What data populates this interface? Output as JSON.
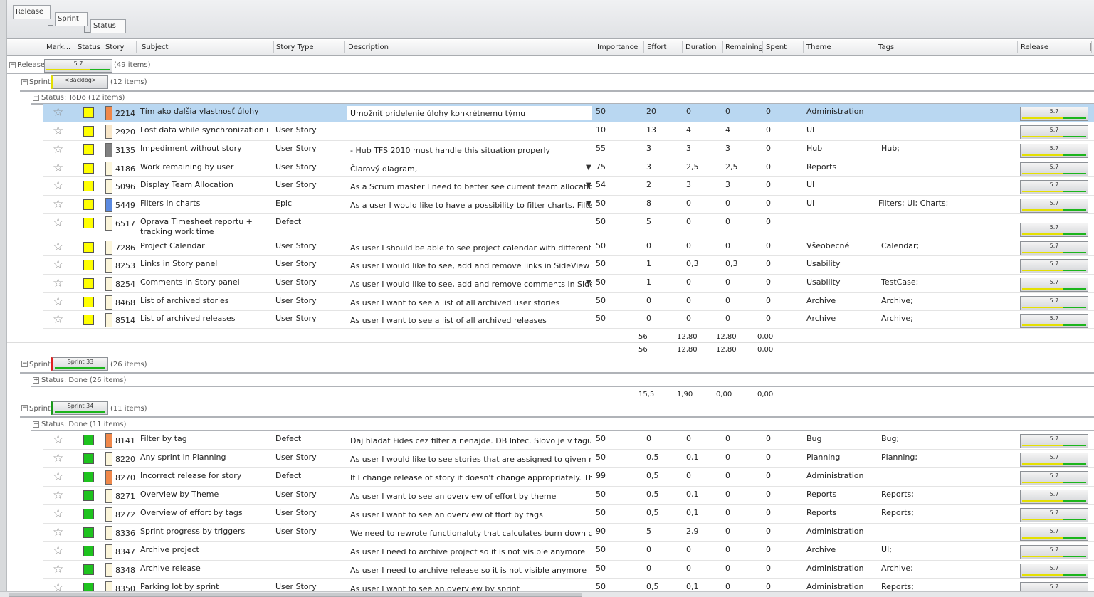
{
  "grouping": {
    "levels": [
      "Release",
      "Sprint",
      "Status"
    ]
  },
  "columns": [
    "Mark...",
    "Status",
    "Story",
    "Subject",
    "Story Type",
    "Description",
    "Importance",
    "Effort",
    "Duration",
    "Remaining",
    "Spent",
    "Theme",
    "Tags",
    "Release"
  ],
  "release_group": {
    "label": "Release:",
    "badge": "5.7",
    "count": "(49 items)"
  },
  "sprint_backlog": {
    "label": "Sprint:",
    "badge": "<Backlog>",
    "count": "(12 items)",
    "status_header": "Status: ToDo (12 items)",
    "rows": [
      {
        "id": "2214",
        "subject": "Tím ako ďalšia vlastnosť úlohy",
        "type": "",
        "description": "Umožniť pridelenie úlohy konkrétnemu týmu",
        "importance": "50",
        "effort": "20",
        "duration": "0",
        "remaining": "0",
        "spent": "0",
        "theme": "Administration",
        "tags": "",
        "release": "5.7",
        "status_color": "#ffff00",
        "swatch": "#f0884a",
        "selected": true,
        "dd": false
      },
      {
        "id": "2920",
        "subject": "Lost data while synchronization runs",
        "type": "User Story",
        "description": "",
        "importance": "10",
        "effort": "13",
        "duration": "4",
        "remaining": "4",
        "spent": "0",
        "theme": "UI",
        "tags": "",
        "release": "5.7",
        "status_color": "#ffff00",
        "swatch": "#f8e6c8",
        "selected": false,
        "dd": false
      },
      {
        "id": "3135",
        "subject": "Impediment without story",
        "type": "User Story",
        "description": "- Hub TFS 2010 must handle this situation properly",
        "importance": "55",
        "effort": "3",
        "duration": "3",
        "remaining": "3",
        "spent": "0",
        "theme": "Hub",
        "tags": "Hub;",
        "release": "5.7",
        "status_color": "#ffff00",
        "swatch": "#808080",
        "selected": false,
        "dd": false
      },
      {
        "id": "4186",
        "subject": "Work remaining by user",
        "type": "User Story",
        "description": "Čiarový diagram,",
        "importance": "75",
        "effort": "3",
        "duration": "2,5",
        "remaining": "2,5",
        "spent": "0",
        "theme": "Reports",
        "tags": "",
        "release": "5.7",
        "status_color": "#ffff00",
        "swatch": "#fbf5da",
        "selected": false,
        "dd": true
      },
      {
        "id": "5096",
        "subject": "Display Team Allocation",
        "type": "User Story",
        "description": "As a Scrum master I need to better see current team allocation. Chec",
        "importance": "54",
        "effort": "2",
        "duration": "3",
        "remaining": "3",
        "spent": "0",
        "theme": "UI",
        "tags": "",
        "release": "5.7",
        "status_color": "#ffff00",
        "swatch": "#fbf5da",
        "selected": false,
        "dd": true
      },
      {
        "id": "5449",
        "subject": "Filters in charts",
        "type": "Epic",
        "description": "As a user I would like to have a possibility to filter charts. Filters shou",
        "importance": "50",
        "effort": "8",
        "duration": "0",
        "remaining": "0",
        "spent": "0",
        "theme": "UI",
        "tags": "Filters; UI; Charts;",
        "release": "5.7",
        "status_color": "#ffff00",
        "swatch": "#5b8ae0",
        "selected": false,
        "dd": true
      },
      {
        "id": "6517",
        "subject": "Oprava Timesheet reportu + tracking work time",
        "type": "Defect",
        "description": "",
        "importance": "50",
        "effort": "5",
        "duration": "0",
        "remaining": "0",
        "spent": "0",
        "theme": "",
        "tags": "",
        "release": "5.7",
        "status_color": "#ffff00",
        "swatch": "#fbf5da",
        "selected": false,
        "dd": false
      },
      {
        "id": "7286",
        "subject": "Project Calendar",
        "type": "User Story",
        "description": "As user I should be able to see project calendar with different events",
        "importance": "50",
        "effort": "0",
        "duration": "0",
        "remaining": "0",
        "spent": "0",
        "theme": "Všeobecné",
        "tags": "Calendar;",
        "release": "5.7",
        "status_color": "#ffff00",
        "swatch": "#fbf5da",
        "selected": false,
        "dd": false
      },
      {
        "id": "8253",
        "subject": "Links in Story panel",
        "type": "User Story",
        "description": "As user I would like to see, add and remove links in SideView story pa",
        "importance": "50",
        "effort": "1",
        "duration": "0,3",
        "remaining": "0,3",
        "spent": "0",
        "theme": "Usability",
        "tags": "",
        "release": "5.7",
        "status_color": "#ffff00",
        "swatch": "#fbf5da",
        "selected": false,
        "dd": false
      },
      {
        "id": "8254",
        "subject": "Comments in Story panel",
        "type": "User Story",
        "description": "As user I would like to see, add and remove comments in SideView sto",
        "importance": "50",
        "effort": "1",
        "duration": "0",
        "remaining": "0",
        "spent": "0",
        "theme": "Usability",
        "tags": "TestCase;",
        "release": "5.7",
        "status_color": "#ffff00",
        "swatch": "#fbf5da",
        "selected": false,
        "dd": true
      },
      {
        "id": "8468",
        "subject": "List of archived stories",
        "type": "User Story",
        "description": "As user I want to see a list of all archived user stories",
        "importance": "50",
        "effort": "0",
        "duration": "0",
        "remaining": "0",
        "spent": "0",
        "theme": "Archive",
        "tags": "Archive;",
        "release": "5.7",
        "status_color": "#ffff00",
        "swatch": "#fbf5da",
        "selected": false,
        "dd": false
      },
      {
        "id": "8514",
        "subject": "List of archived releases",
        "type": "User Story",
        "description": "As user I want to see a list of all archived releases",
        "importance": "50",
        "effort": "0",
        "duration": "0",
        "remaining": "0",
        "spent": "0",
        "theme": "Archive",
        "tags": "Archive;",
        "release": "5.7",
        "status_color": "#ffff00",
        "swatch": "#fbf5da",
        "selected": false,
        "dd": false
      }
    ],
    "totals_status": {
      "effort": "56",
      "duration": "12,80",
      "remaining": "12,80",
      "spent": "0,00"
    },
    "totals_sprint": {
      "effort": "56",
      "duration": "12,80",
      "remaining": "12,80",
      "spent": "0,00"
    }
  },
  "sprint_33": {
    "label": "Sprint:",
    "badge": "Sprint 33",
    "count": "(26 items)",
    "status_header": "Status: Done (26 items)",
    "totals": {
      "effort": "15,5",
      "duration": "1,90",
      "remaining": "0,00",
      "spent": "0,00"
    }
  },
  "sprint_34": {
    "label": "Sprint:",
    "badge": "Sprint 34",
    "count": "(11 items)",
    "status_header": "Status: Done (11 items)",
    "rows": [
      {
        "id": "8141",
        "subject": "Filter by tag",
        "type": "Defect",
        "description": "Daj hladat Fides cez filter a nenajde. DB Intec. Slovo je v tagu, pravedo",
        "importance": "50",
        "effort": "0",
        "duration": "0",
        "remaining": "0",
        "spent": "0",
        "theme": "Bug",
        "tags": "Bug;",
        "release": "5.7",
        "status_color": "#1ec31e",
        "swatch": "#f0884a"
      },
      {
        "id": "8220",
        "subject": "Any sprint in Planning",
        "type": "User Story",
        "description": "As user I would like to see stories that are assigned to given release ar",
        "importance": "50",
        "effort": "0,5",
        "duration": "0,1",
        "remaining": "0",
        "spent": "0",
        "theme": "Planning",
        "tags": "Planning;",
        "release": "5.7",
        "status_color": "#1ec31e",
        "swatch": "#fbf5da"
      },
      {
        "id": "8270",
        "subject": "Incorrect release for story",
        "type": "Defect",
        "description": "If I change release of story it doesn't change appropriately. The value i",
        "importance": "99",
        "effort": "0,5",
        "duration": "0",
        "remaining": "0",
        "spent": "0",
        "theme": "Administration",
        "tags": "",
        "release": "5.7",
        "status_color": "#1ec31e",
        "swatch": "#f0884a"
      },
      {
        "id": "8271",
        "subject": "Overview by Theme",
        "type": "User Story",
        "description": "As user I want to see an overview of effort by theme",
        "importance": "50",
        "effort": "0,5",
        "duration": "0,1",
        "remaining": "0",
        "spent": "0",
        "theme": "Reports",
        "tags": "Reports;",
        "release": "5.7",
        "status_color": "#1ec31e",
        "swatch": "#fbf5da"
      },
      {
        "id": "8272",
        "subject": "Overview of effort by tags",
        "type": "User Story",
        "description": "As user I want to see an overview of ffort by tags",
        "importance": "50",
        "effort": "0,5",
        "duration": "0,1",
        "remaining": "0",
        "spent": "0",
        "theme": "Reports",
        "tags": "Reports;",
        "release": "5.7",
        "status_color": "#1ec31e",
        "swatch": "#fbf5da"
      },
      {
        "id": "8336",
        "subject": "Sprint progress by triggers",
        "type": "User Story",
        "description": "We need to rewrote functionaluty that calculates burn down charts.",
        "importance": "90",
        "effort": "5",
        "duration": "2,9",
        "remaining": "0",
        "spent": "0",
        "theme": "Administration",
        "tags": "",
        "release": "5.7",
        "status_color": "#1ec31e",
        "swatch": "#fbf5da"
      },
      {
        "id": "8347",
        "subject": "Archive project",
        "type": "",
        "description": "As user I need to archive project so it is not visible anymore",
        "importance": "50",
        "effort": "0",
        "duration": "0",
        "remaining": "0",
        "spent": "0",
        "theme": "Archive",
        "tags": "UI;",
        "release": "5.7",
        "status_color": "#1ec31e",
        "swatch": "#fbf5da"
      },
      {
        "id": "8348",
        "subject": "Archive release",
        "type": "",
        "description": "As user I need to archive release so it is not visible anymore",
        "importance": "50",
        "effort": "0",
        "duration": "0",
        "remaining": "0",
        "spent": "0",
        "theme": "Administration",
        "tags": "Archive;",
        "release": "5.7",
        "status_color": "#1ec31e",
        "swatch": "#fbf5da"
      },
      {
        "id": "8350",
        "subject": "Parking lot by sprint",
        "type": "User Story",
        "description": "As user I want to see an overview by sprint",
        "importance": "50",
        "effort": "0,5",
        "duration": "0,1",
        "remaining": "0",
        "spent": "0",
        "theme": "Administration",
        "tags": "Reports;",
        "release": "5.7",
        "status_color": "#1ec31e",
        "swatch": "#fbf5da"
      }
    ]
  },
  "colors": {
    "selected_row": "#b9d7f1",
    "todo": "#ffff00",
    "done": "#1ec31e",
    "sprint33_accent": "#e02020",
    "sprint34_accent": "#1a9a1a"
  }
}
